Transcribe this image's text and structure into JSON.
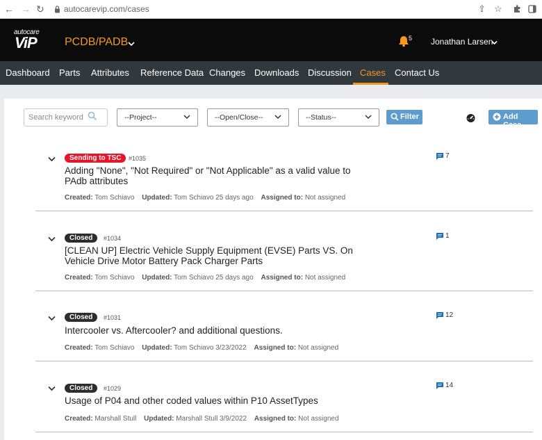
{
  "browser": {
    "url": "autocarevip.com/cases",
    "icons": [
      "back-arrow-icon",
      "forward-arrow-icon",
      "reload-icon",
      "lock-icon",
      "share-icon",
      "star-icon",
      "extensions-icon",
      "sidebar-icon"
    ]
  },
  "header": {
    "logo_top": "autocare",
    "logo_main": "ViP",
    "product": "PCDB/PADB",
    "notification_count": "5",
    "user": "Jonathan Larsen",
    "accent_color": "#f39a1e"
  },
  "nav": {
    "items": [
      {
        "label": "Dashboard"
      },
      {
        "label": "Parts"
      },
      {
        "label": "Attributes"
      },
      {
        "label": "Reference Data"
      },
      {
        "label": "Changes"
      },
      {
        "label": "Downloads"
      },
      {
        "label": "Discussion"
      },
      {
        "label": "Cases",
        "active": true
      },
      {
        "label": "Contact Us"
      }
    ]
  },
  "toolbar": {
    "search_placeholder": "Search keyword",
    "project_select": "--Project--",
    "openclose_select": "--Open/Close--",
    "status_select": "--Status--",
    "filter_label": "Filter",
    "add_case_label": "Add Case"
  },
  "labels": {
    "created": "Created:",
    "updated": "Updated:",
    "assigned": "Assigned to:"
  },
  "cases": [
    {
      "status": "Sending to TSC",
      "status_color": "#e8142a",
      "number": "#1035",
      "title": "Adding \"None\", \"Not Required\" or \"Not Applicable\" as a valid value to PAdb attributes",
      "created_by": "Tom Schiavo",
      "updated": "Tom Schiavo 25 days ago",
      "assigned_to": "Not assigned",
      "comment_count": "7"
    },
    {
      "status": "Closed",
      "status_color": "#2d2d2d",
      "number": "#1034",
      "title": "[CLEAN UP] Electric Vehicle Supply Equipment (EVSE) Parts VS. On Vehicle Drive Motor Battery Pack Charger Parts",
      "created_by": "Tom Schiavo",
      "updated": "Tom Schiavo 25 days ago",
      "assigned_to": "Not assigned",
      "comment_count": "1"
    },
    {
      "status": "Closed",
      "status_color": "#2d2d2d",
      "number": "#1031",
      "title": "Intercooler vs. Aftercooler? and additional questions.",
      "created_by": "Tom Schiavo",
      "updated": "Tom Schiavo 3/23/2022",
      "assigned_to": "Not assigned",
      "comment_count": "12"
    },
    {
      "status": "Closed",
      "status_color": "#2d2d2d",
      "number": "#1029",
      "title": "Usage of P04 and other coded values within P10 AssetTypes",
      "created_by": "Marshall Stull",
      "updated": "Marshall Stull 3/9/2022",
      "assigned_to": "Not assigned",
      "comment_count": "14"
    }
  ]
}
